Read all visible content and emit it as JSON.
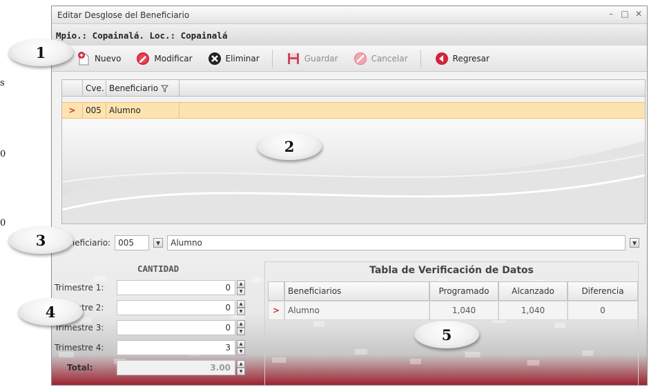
{
  "window": {
    "title": "Editar Desglose del Beneficiario",
    "controls": [
      "minimize-icon",
      "maximize-icon",
      "close-icon"
    ]
  },
  "location": "Mpio.: Copainalá. Loc.: Copainalá",
  "toolbar": {
    "nuevo": "Nuevo",
    "modificar": "Modificar",
    "eliminar": "Eliminar",
    "guardar": "Guardar",
    "cancelar": "Cancelar",
    "regresar": "Regresar"
  },
  "grid": {
    "columns": [
      "Cve.",
      "Beneficiario"
    ],
    "rows": [
      {
        "cve": "005",
        "beneficiario": "Alumno"
      }
    ]
  },
  "form": {
    "label": "Beneficiario:",
    "code": "005",
    "name": "Alumno"
  },
  "cantidad": {
    "title": "CANTIDAD",
    "rows": [
      {
        "label": "Trimestre 1:",
        "value": "0"
      },
      {
        "label": "Trimestre 2:",
        "value": "0"
      },
      {
        "label": "Trimestre 3:",
        "value": "0"
      },
      {
        "label": "Trimestre 4:",
        "value": "3"
      }
    ],
    "total_label": "Total:",
    "total_value": "3.00"
  },
  "verificacion": {
    "title": "Tabla de Verificación de Datos",
    "columns": [
      "Beneficiarios",
      "Programado",
      "Alcanzado",
      "Diferencia"
    ],
    "rows": [
      {
        "beneficiario": "Alumno",
        "programado": "1,040",
        "alcanzado": "1,040",
        "diferencia": "0"
      }
    ]
  },
  "callouts": [
    "1",
    "2",
    "3",
    "4",
    "5"
  ],
  "stray_text": [
    "s",
    "0",
    "0"
  ],
  "colors": {
    "highlight_row": "#fde3b0",
    "accent_red": "#9b1c2a",
    "row_marker": "#cc3333"
  }
}
